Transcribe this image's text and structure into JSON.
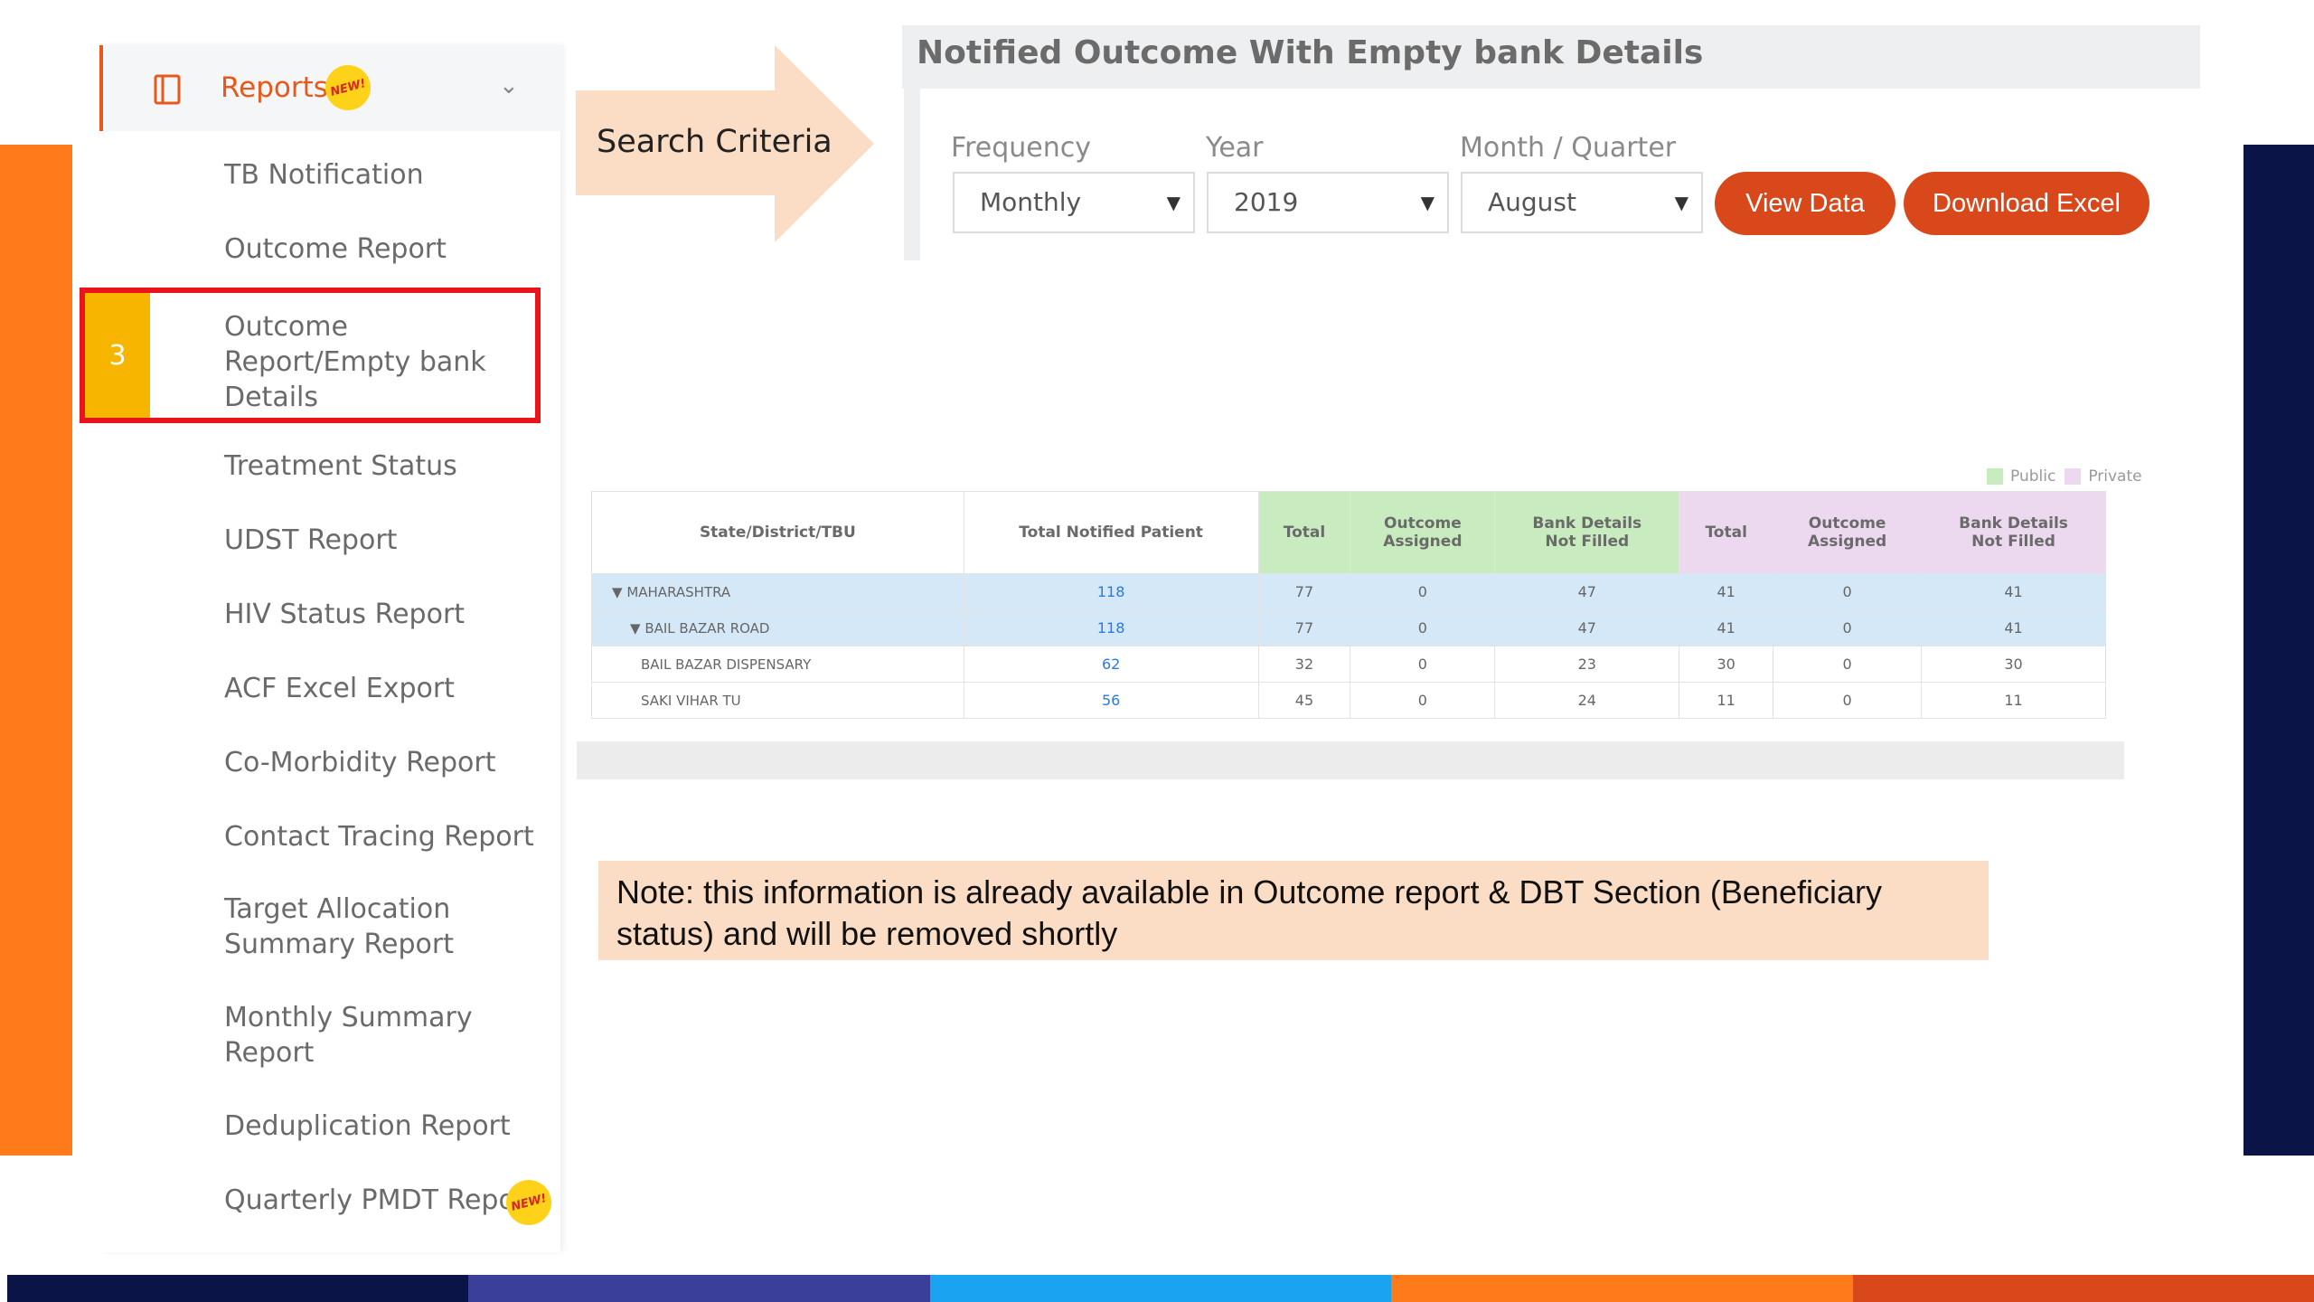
{
  "sidebar": {
    "header": {
      "title": "Reports",
      "badge": "NEW!"
    },
    "items": [
      {
        "label": "TB Notification"
      },
      {
        "label": "Outcome Report"
      },
      {
        "label": "Outcome\nReport/Empty bank\nDetails",
        "step": "3"
      },
      {
        "label": "Treatment Status"
      },
      {
        "label": "UDST Report"
      },
      {
        "label": "HIV Status Report"
      },
      {
        "label": "ACF Excel Export"
      },
      {
        "label": "Co-Morbidity Report"
      },
      {
        "label": "Contact Tracing Report"
      },
      {
        "label": "Target Allocation\nSummary Report"
      },
      {
        "label": "Monthly Summary\nReport"
      },
      {
        "label": "Deduplication Report"
      },
      {
        "label": "Quarterly PMDT Report",
        "badge": "NEW!"
      }
    ]
  },
  "callout": {
    "label": "Search Criteria"
  },
  "panel": {
    "title": "Notified Outcome With Empty bank Details",
    "filters": {
      "frequency": {
        "label": "Frequency",
        "value": "Monthly"
      },
      "year": {
        "label": "Year",
        "value": "2019"
      },
      "month": {
        "label": "Month / Quarter",
        "value": "August"
      }
    },
    "buttons": {
      "view": "View Data",
      "download": "Download Excel"
    }
  },
  "legend": {
    "public": "Public",
    "private": "Private"
  },
  "table": {
    "headers": {
      "name": "State/District/TBU",
      "total_notified": "Total Notified Patient",
      "pub_total": "Total",
      "pub_outcome": "Outcome\nAssigned",
      "pub_bank": "Bank Details\nNot Filled",
      "pri_total": "Total",
      "pri_outcome": "Outcome\nAssigned",
      "pri_bank": "Bank Details\nNot Filled"
    },
    "rows": [
      {
        "name": "MAHARASHTRA",
        "toggle": "▼",
        "level": 0,
        "total": "118",
        "pub_total": "77",
        "pub_outcome": "0",
        "pub_bank": "47",
        "pri_total": "41",
        "pri_outcome": "0",
        "pri_bank": "41"
      },
      {
        "name": "BAIL BAZAR ROAD",
        "toggle": "▼",
        "level": 1,
        "total": "118",
        "pub_total": "77",
        "pub_outcome": "0",
        "pub_bank": "47",
        "pri_total": "41",
        "pri_outcome": "0",
        "pri_bank": "41"
      },
      {
        "name": "BAIL BAZAR DISPENSARY",
        "toggle": "",
        "level": 2,
        "total": "62",
        "pub_total": "32",
        "pub_outcome": "0",
        "pub_bank": "23",
        "pri_total": "30",
        "pri_outcome": "0",
        "pri_bank": "30"
      },
      {
        "name": "SAKI VIHAR TU",
        "toggle": "",
        "level": 2,
        "total": "56",
        "pub_total": "45",
        "pub_outcome": "0",
        "pub_bank": "24",
        "pri_total": "11",
        "pri_outcome": "0",
        "pri_bank": "11"
      }
    ]
  },
  "note": "Note: this information is already available in Outcome report & DBT Section (Beneficiary status) and will be removed shortly",
  "colors": {
    "accent_orange": "#e8581b",
    "button": "#d9481b",
    "public_header": "#c8ecbf",
    "private_header": "#ecd9ef",
    "selected_row": "#d5e8f7",
    "highlight_border": "#e8131b",
    "step_badge": "#f7b500",
    "bottom_strip": [
      "#0b1447",
      "#3a3f9a",
      "#1aa3f0",
      "#ff7a1a",
      "#d9481b"
    ]
  },
  "icons": {
    "reports": "book-icon",
    "expand": "chevron-down-icon"
  }
}
